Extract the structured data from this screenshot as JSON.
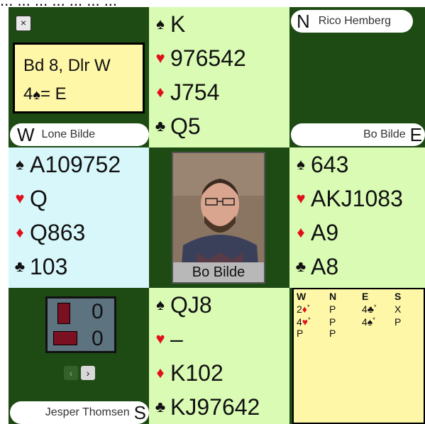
{
  "top_caption": "... ... ... ...  ... ... ...",
  "board_info": {
    "line1": "Bd 8, Dlr W",
    "line2_prefix": "4",
    "line2_suit": "♠",
    "line2_suffix": "= E"
  },
  "players": {
    "north": {
      "seat": "N",
      "name": "Rico Hemberg"
    },
    "west": {
      "seat": "W",
      "name": "Lone Bilde"
    },
    "east": {
      "seat": "E",
      "name": "Bo Bilde"
    },
    "south": {
      "seat": "S",
      "name": "Jesper Thomsen"
    }
  },
  "video_label": "Bo Bilde",
  "hands": {
    "north": {
      "spades": "K",
      "hearts": "976542",
      "diamonds": "J754",
      "clubs": "Q5"
    },
    "west": {
      "spades": "A109752",
      "hearts": "Q",
      "diamonds": "Q863",
      "clubs": "103"
    },
    "east": {
      "spades": "643",
      "hearts": "AKJ1083",
      "diamonds": "A9",
      "clubs": "A8"
    },
    "south": {
      "spades": "QJ8",
      "hearts": "–",
      "diamonds": "K102",
      "clubs": "KJ97642"
    }
  },
  "suits": {
    "spade": "♠",
    "heart": "♥",
    "diamond": "♦",
    "club": "♣"
  },
  "tricks": {
    "ns": "0",
    "ew": "0"
  },
  "nav": {
    "prev": "‹",
    "next": "›"
  },
  "close_icon": "×",
  "bidding": {
    "headers": [
      "W",
      "N",
      "E",
      "S"
    ],
    "rows": [
      [
        "2♦*",
        "P",
        "4♣*",
        "X"
      ],
      [
        "4♥*",
        "P",
        "4♠*",
        "P"
      ],
      [
        "P",
        "P",
        "",
        ""
      ]
    ]
  },
  "colors": {
    "table_green": "#1e4a14",
    "hand_green": "#d9fbb4",
    "hand_blue": "#d8f7fb",
    "info_yellow": "#fff7a8",
    "red_suit": "#e0101a"
  }
}
